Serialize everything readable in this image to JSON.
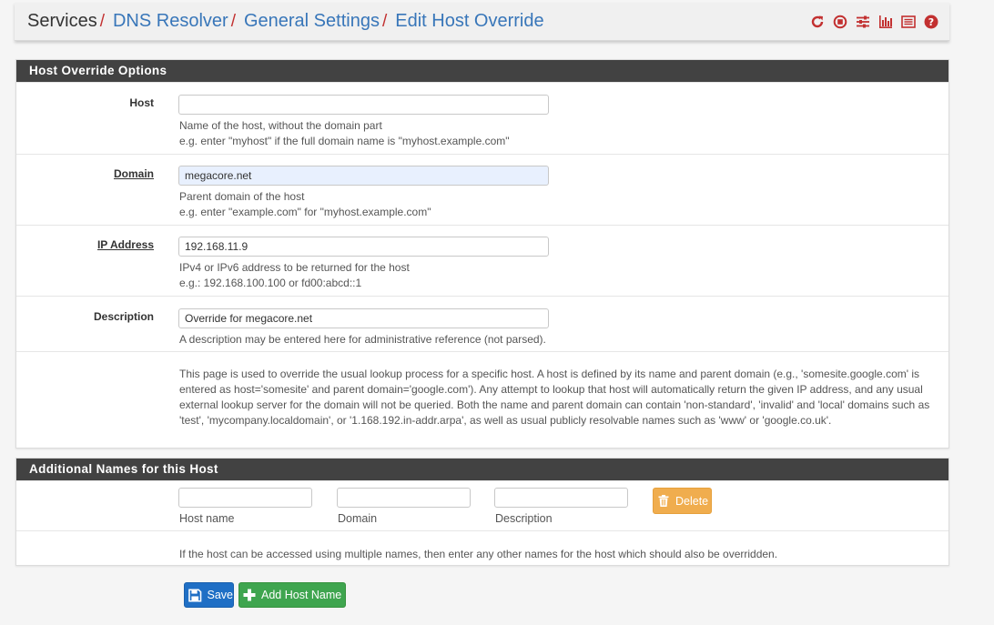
{
  "breadcrumb": {
    "items": [
      "Services",
      "DNS Resolver",
      "General Settings",
      "Edit Host Override"
    ],
    "separator": "/"
  },
  "header_icons": [
    "reload-icon",
    "stop-icon",
    "sliders-icon",
    "bar-chart-icon",
    "log-icon",
    "help-icon"
  ],
  "colors": {
    "accent_red": "#c23030",
    "link_blue": "#3876b9",
    "panel_heading": "#424242",
    "save_blue": "#1f6fc5",
    "add_green": "#3fa54f",
    "delete_orange": "#f0ad4e"
  },
  "host_override": {
    "heading": "Host Override Options",
    "host": {
      "label": "Host",
      "value": "",
      "help_line1": "Name of the host, without the domain part",
      "help_line2": "e.g. enter \"myhost\" if the full domain name is \"myhost.example.com\""
    },
    "domain": {
      "label": "Domain",
      "value": "megacore.net",
      "help_line1": "Parent domain of the host",
      "help_line2": "e.g. enter \"example.com\" for \"myhost.example.com\""
    },
    "ip": {
      "label": "IP Address",
      "value": "192.168.11.9",
      "help_line1": "IPv4 or IPv6 address to be returned for the host",
      "help_line2": "e.g.: 192.168.100.100 or fd00:abcd::1"
    },
    "description": {
      "label": "Description",
      "value": "Override for megacore.net",
      "help_line1": "A description may be entered here for administrative reference (not parsed)."
    },
    "info_text": "This page is used to override the usual lookup process for a specific host. A host is defined by its name and parent domain (e.g., 'somesite.google.com' is entered as host='somesite' and parent domain='google.com'). Any attempt to lookup that host will automatically return the given IP address, and any usual external lookup server for the domain will not be queried. Both the name and parent domain can contain 'non-standard', 'invalid' and 'local' domains such as 'test', 'mycompany.localdomain', or '1.168.192.in-addr.arpa', as well as usual publicly resolvable names such as 'www' or 'google.co.uk'."
  },
  "additional_names": {
    "heading": "Additional Names for this Host",
    "hostname_label": "Host name",
    "hostname_value": "",
    "domain_label": "Domain",
    "domain_value": "",
    "description_label": "Description",
    "description_value": "",
    "delete_label": "Delete",
    "help_text": "If the host can be accessed using multiple names, then enter any other names for the host which should also be overridden."
  },
  "actions": {
    "save_label": "Save",
    "add_label": "Add Host Name"
  }
}
